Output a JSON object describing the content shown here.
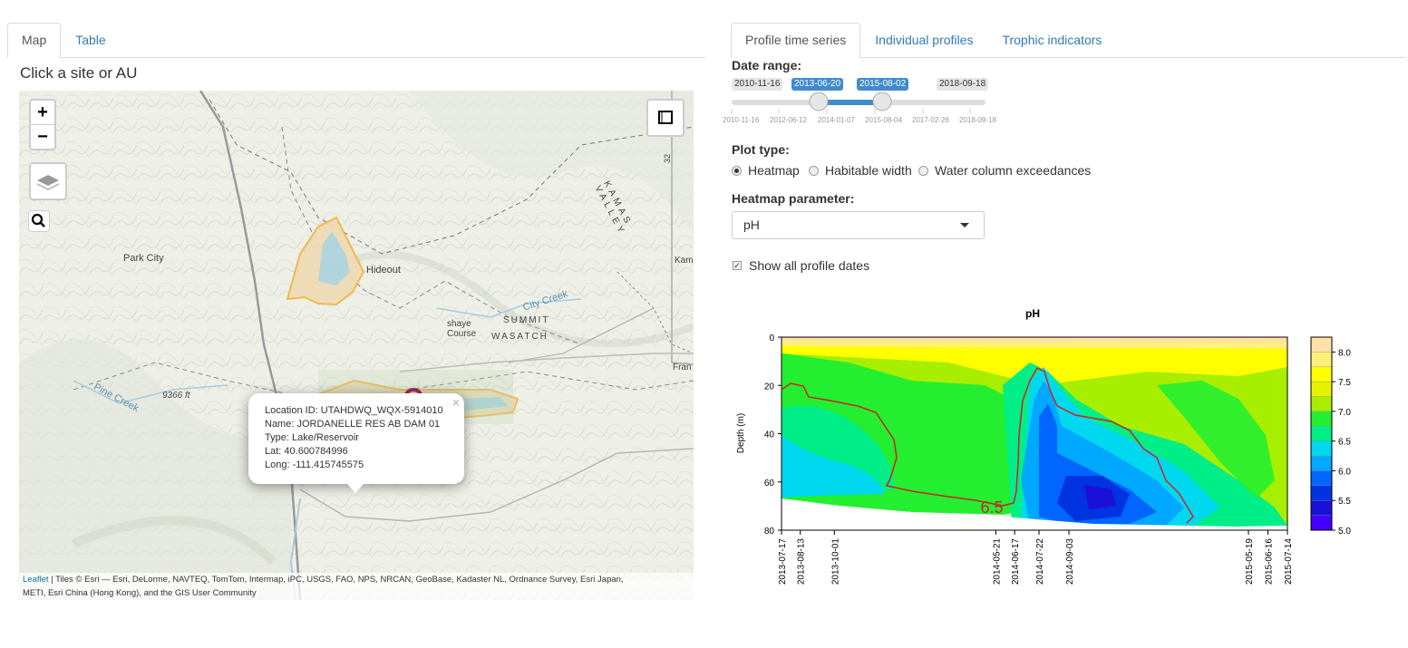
{
  "left_tabs": [
    "Map",
    "Table"
  ],
  "right_tabs": [
    "Profile time series",
    "Individual profiles",
    "Trophic indicators"
  ],
  "map": {
    "hint": "Click a site or AU",
    "zoom_in": "+",
    "zoom_out": "−",
    "place_labels": [
      "Park City",
      "Hideout",
      "SUMMIT",
      "WASATCH",
      "City Creek",
      "Pine Creek",
      "KAMAS VALLEY",
      "9366 ft",
      "Kam",
      "Fran",
      "32",
      "Course",
      "shaye"
    ],
    "popup": {
      "location_id": "Location ID: UTAHDWQ_WQX-5914010",
      "name": "Name: JORDANELLE RES AB DAM 01",
      "type": "Type: Lake/Reservoir",
      "lat": "Lat: 40.600784996",
      "long": "Long: -111.415745575",
      "close": "×"
    },
    "attribution_link": "Leaflet",
    "attribution_text": " | Tiles © Esri — Esri, DeLorme, NAVTEQ, TomTom, Intermap, iPC, USGS, FAO, NPS, NRCAN, GeoBase, Kadaster NL, Ordnance Survey, Esri Japan,",
    "attribution_text2": "METI, Esri China (Hong Kong), and the GIS User Community",
    "colors": {
      "marker": "#9c2a5a",
      "boundary": "#f2b33d",
      "water": "#a8d4e0"
    }
  },
  "controls": {
    "date_range_label": "Date range:",
    "date_min": "2010-11-16",
    "date_max": "2018-09-18",
    "date_from": "2013-06-20",
    "date_to": "2015-08-02",
    "ticks": [
      "2010-11-16",
      "2012-06-12",
      "2014-01-07",
      "2015-08-04",
      "2017-02-26",
      "2018-09-18"
    ],
    "plot_type_label": "Plot type:",
    "plot_types": [
      "Heatmap",
      "Habitable width",
      "Water column exceedances"
    ],
    "plot_type_selected": "Heatmap",
    "heatmap_param_label": "Heatmap parameter:",
    "heatmap_param": "pH",
    "show_all_label": "Show all profile dates",
    "show_all_checked": true
  },
  "chart_data": {
    "type": "heatmap",
    "title": "pH",
    "ylabel": "Depth (m)",
    "ylim": [
      80,
      0
    ],
    "y_ticks": [
      0,
      20,
      40,
      60,
      80
    ],
    "x": [
      "2013-07-17",
      "2013-08-13",
      "2013-10-01",
      "2014-05-21",
      "2014-06-17",
      "2014-07-22",
      "2014-09-03",
      "2015-05-19",
      "2015-06-16",
      "2015-07-14"
    ],
    "z_levels": [
      5.0,
      5.25,
      5.5,
      5.75,
      6.0,
      6.25,
      6.5,
      6.75,
      7.0,
      7.25,
      7.5,
      7.75,
      8.0,
      8.25
    ],
    "legend_ticks": [
      "8.0",
      "7.5",
      "7.0",
      "6.5",
      "6.0",
      "5.5",
      "5.0"
    ],
    "contour_label": "6.5",
    "colors": {
      "contour": "#cc2222"
    }
  }
}
